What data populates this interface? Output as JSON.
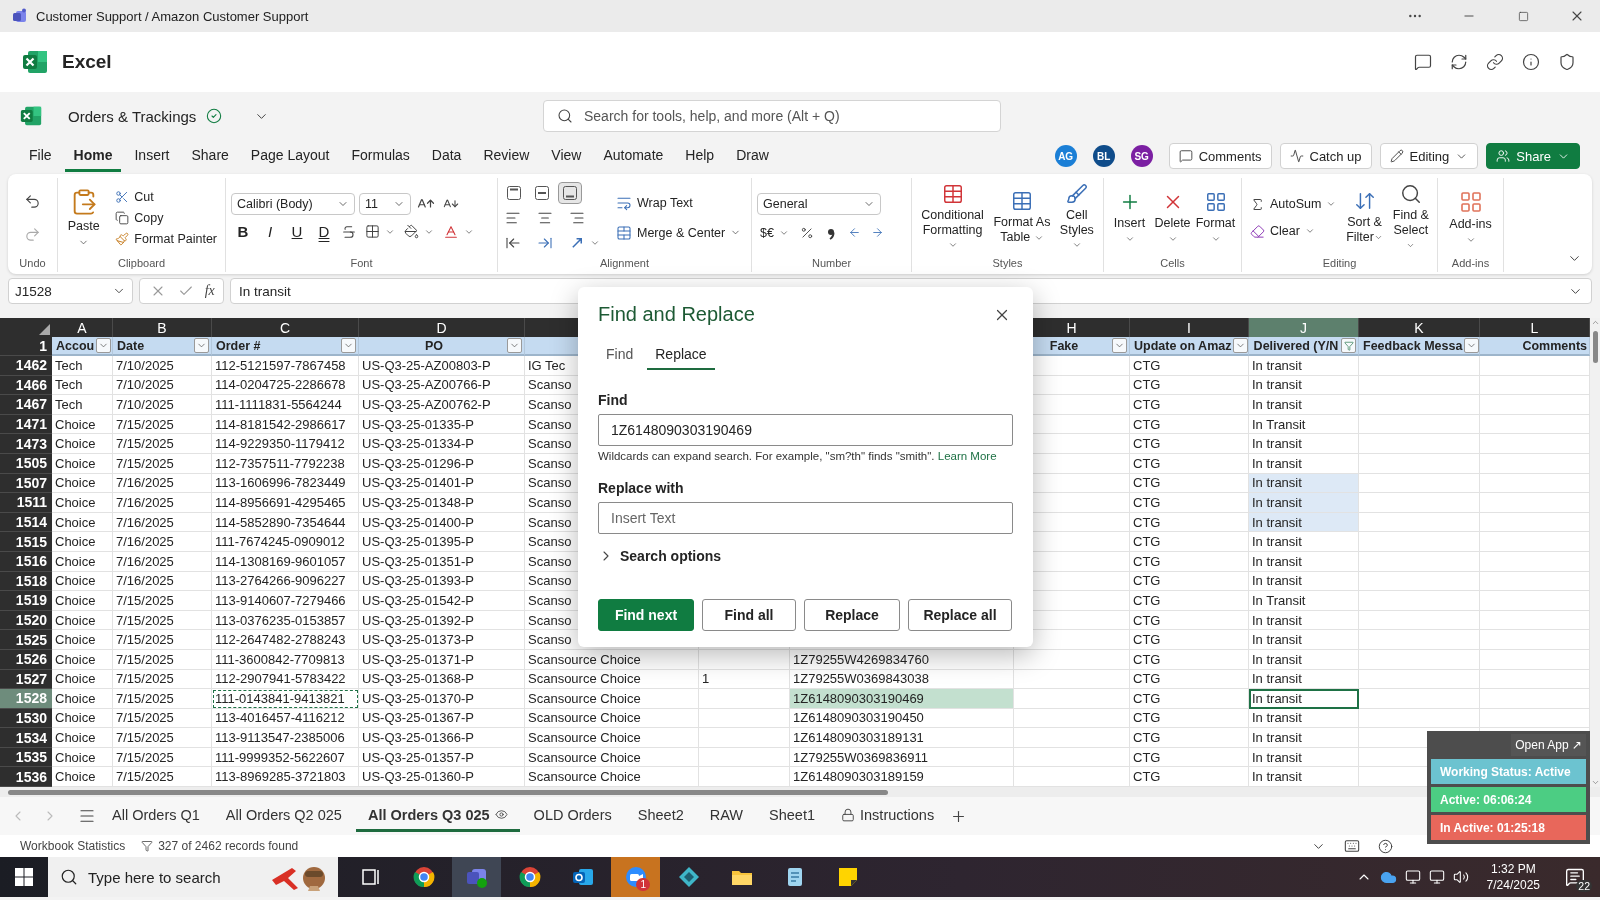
{
  "window": {
    "title": "Customer Support / Amazon Customer Support"
  },
  "app": {
    "name": "Excel"
  },
  "document": {
    "title": "Orders & Trackings",
    "search_placeholder": "Search for tools, help, and more (Alt + Q)"
  },
  "menu": [
    {
      "label": "File",
      "selected": false
    },
    {
      "label": "Home",
      "selected": true
    },
    {
      "label": "Insert",
      "selected": false
    },
    {
      "label": "Share",
      "selected": false
    },
    {
      "label": "Page Layout",
      "selected": false
    },
    {
      "label": "Formulas",
      "selected": false
    },
    {
      "label": "Data",
      "selected": false
    },
    {
      "label": "Review",
      "selected": false
    },
    {
      "label": "View",
      "selected": false
    },
    {
      "label": "Automate",
      "selected": false
    },
    {
      "label": "Help",
      "selected": false
    },
    {
      "label": "Draw",
      "selected": false
    }
  ],
  "collaborators": [
    {
      "initials": "AG",
      "color": "#1b7fd6"
    },
    {
      "initials": "BL",
      "color": "#0f4c8a"
    },
    {
      "initials": "SG",
      "color": "#7b1fa2"
    }
  ],
  "header_buttons": [
    {
      "label": "Comments",
      "kind": "comments"
    },
    {
      "label": "Catch up",
      "kind": "catchup"
    },
    {
      "label": "Editing",
      "kind": "editing"
    },
    {
      "label": "Share",
      "kind": "share"
    }
  ],
  "ribbon": {
    "undo": {
      "group": "Undo"
    },
    "clipboard": {
      "paste": "Paste",
      "cut": "Cut",
      "copy": "Copy",
      "format_painter": "Format Painter",
      "group": "Clipboard"
    },
    "font": {
      "name": "Calibri (Body)",
      "size": "11",
      "styles": [
        "B",
        "I",
        "U",
        "D"
      ],
      "group": "Font"
    },
    "alignment": {
      "vertical": [
        {
          "selected": false
        },
        {
          "selected": false
        },
        {
          "selected": true
        }
      ],
      "wrap": "Wrap Text",
      "merge": "Merge & Center",
      "group": "Alignment"
    },
    "number": {
      "format": "General",
      "currency": "$€",
      "group": "Number"
    },
    "styles": {
      "buttons": [
        "Conditional Formatting",
        "Format As Table",
        "Cell Styles"
      ],
      "group": "Styles"
    },
    "cells": {
      "buttons": [
        "Insert",
        "Delete",
        "Format"
      ],
      "group": "Cells"
    },
    "editing": {
      "autosum": "AutoSum",
      "clear": "Clear",
      "buttons": [
        "Sort & Filter",
        "Find & Select"
      ],
      "group": "Editing"
    },
    "addins": {
      "button": "Add-ins",
      "group": "Add-ins"
    }
  },
  "formula_bar": {
    "cell": "J1528",
    "function_label": "fx",
    "value": "In transit"
  },
  "grid": {
    "columns_left": [
      {
        "letter": "A",
        "heading": "Accou",
        "kind": "dropdown",
        "selected": false
      },
      {
        "letter": "B",
        "heading": "Date",
        "kind": "dropdown",
        "selected": false
      },
      {
        "letter": "C",
        "heading": "Order #",
        "kind": "dropdown",
        "selected": false
      },
      {
        "letter": "D",
        "heading": "PO",
        "kind": "dropdown",
        "selected": false
      }
    ],
    "columns_right": [
      {
        "letter": "H",
        "heading": "Fake",
        "kind": "dropdown",
        "selected": false
      },
      {
        "letter": "I",
        "heading": "Update on Amaz",
        "kind": "dropdown",
        "selected": false
      },
      {
        "letter": "J",
        "heading": "Delivered (Y/N",
        "kind": "filtered",
        "selected": true
      },
      {
        "letter": "K",
        "heading": "Feedback Messa",
        "kind": "dropdown",
        "selected": false
      },
      {
        "letter": "L",
        "heading": "Comments",
        "kind": "plain",
        "selected": false
      }
    ],
    "header_row": "1",
    "rows": [
      {
        "number": "1462",
        "account": "Tech",
        "date": "7/10/2025",
        "order": "112-5121597-7867458",
        "po": "US-Q3-25-AZ00803-P",
        "column_e": "IG Tec",
        "update": "CTG",
        "delivered": "In transit",
        "selected": false,
        "highlighted": false
      },
      {
        "number": "1466",
        "account": "Tech",
        "date": "7/10/2025",
        "order": "114-0204725-2286678",
        "po": "US-Q3-25-AZ00766-P",
        "column_e": "Scanso",
        "update": "CTG",
        "delivered": "In transit",
        "selected": false,
        "highlighted": false
      },
      {
        "number": "1467",
        "account": "Tech",
        "date": "7/10/2025",
        "order": "111-1111831-5564244",
        "po": "US-Q3-25-AZ00762-P",
        "column_e": "Scanso",
        "update": "CTG",
        "delivered": "In transit",
        "selected": false,
        "highlighted": false
      },
      {
        "number": "1471",
        "account": "Choice",
        "date": "7/15/2025",
        "order": "114-8181542-2986617",
        "po": "US-Q3-25-01335-P",
        "column_e": "Scanso",
        "update": "CTG",
        "delivered": "In Transit",
        "selected": false,
        "highlighted": false
      },
      {
        "number": "1473",
        "account": "Choice",
        "date": "7/15/2025",
        "order": "114-9229350-1179412",
        "po": "US-Q3-25-01334-P",
        "column_e": "Scanso",
        "update": "CTG",
        "delivered": "In transit",
        "selected": false,
        "highlighted": false
      },
      {
        "number": "1505",
        "account": "Choice",
        "date": "7/15/2025",
        "order": "112-7357511-7792238",
        "po": "US-Q3-25-01296-P",
        "column_e": "Scanso",
        "update": "CTG",
        "delivered": "In transit",
        "selected": false,
        "highlighted": false
      },
      {
        "number": "1507",
        "account": "Choice",
        "date": "7/16/2025",
        "order": "113-1606996-7823449",
        "po": "US-Q3-25-01401-P",
        "column_e": "Scanso",
        "update": "CTG",
        "delivered": "In transit",
        "selected": false,
        "highlighted": true
      },
      {
        "number": "1511",
        "account": "Choice",
        "date": "7/16/2025",
        "order": "114-8956691-4295465",
        "po": "US-Q3-25-01348-P",
        "column_e": "Scanso",
        "update": "CTG",
        "delivered": "In transit",
        "selected": false,
        "highlighted": true
      },
      {
        "number": "1514",
        "account": "Choice",
        "date": "7/16/2025",
        "order": "114-5852890-7354644",
        "po": "US-Q3-25-01400-P",
        "column_e": "Scanso",
        "update": "CTG",
        "delivered": "In transit",
        "selected": false,
        "highlighted": true
      },
      {
        "number": "1515",
        "account": "Choice",
        "date": "7/16/2025",
        "order": "111-7674245-0909012",
        "po": "US-Q3-25-01395-P",
        "column_e": "Scanso",
        "update": "CTG",
        "delivered": "In transit",
        "selected": false,
        "highlighted": false
      },
      {
        "number": "1516",
        "account": "Choice",
        "date": "7/16/2025",
        "order": "114-1308169-9601057",
        "po": "US-Q3-25-01351-P",
        "column_e": "Scanso",
        "update": "CTG",
        "delivered": "In transit",
        "selected": false,
        "highlighted": false
      },
      {
        "number": "1518",
        "account": "Choice",
        "date": "7/16/2025",
        "order": "113-2764266-9096227",
        "po": "US-Q3-25-01393-P",
        "column_e": "Scanso",
        "update": "CTG",
        "delivered": "In transit",
        "selected": false,
        "highlighted": false
      },
      {
        "number": "1519",
        "account": "Choice",
        "date": "7/15/2025",
        "order": "113-9140607-7279466",
        "po": "US-Q3-25-01542-P",
        "column_e": "Scanso",
        "update": "CTG",
        "delivered": "In Transit",
        "selected": false,
        "highlighted": false
      },
      {
        "number": "1520",
        "account": "Choice",
        "date": "7/15/2025",
        "order": "113-0376235-0153857",
        "po": "US-Q3-25-01392-P",
        "column_e": "Scanso",
        "update": "CTG",
        "delivered": "In transit",
        "selected": false,
        "highlighted": false
      },
      {
        "number": "1525",
        "account": "Choice",
        "date": "7/15/2025",
        "order": "112-2647482-2788243",
        "po": "US-Q3-25-01373-P",
        "column_e": "Scanso",
        "update": "CTG",
        "delivered": "In transit",
        "selected": false,
        "highlighted": false
      },
      {
        "number": "1526",
        "account": "Choice",
        "date": "7/15/2025",
        "order": "111-3600842-7709813",
        "po": "US-Q3-25-01371-P",
        "column_e": "Scansource Choice",
        "column_g": "1Z79255W4269834760",
        "update": "CTG",
        "delivered": "In transit",
        "selected": false,
        "highlighted": false
      },
      {
        "number": "1527",
        "account": "Choice",
        "date": "7/15/2025",
        "order": "112-2907941-5783422",
        "po": "US-Q3-25-01368-P",
        "column_e": "Scansource Choice",
        "column_f": "1",
        "column_g": "1Z79255W0369843038",
        "update": "CTG",
        "delivered": "In transit",
        "selected": false,
        "highlighted": false
      },
      {
        "number": "1528",
        "account": "Choice",
        "date": "7/15/2025",
        "order": "111-0143841-9413821",
        "po": "US-Q3-25-01370-P",
        "column_e": "Scansource Choice",
        "column_g": "1Z6148090303190469",
        "update": "CTG",
        "delivered": "In transit",
        "selected": true,
        "highlighted": false
      },
      {
        "number": "1530",
        "account": "Choice",
        "date": "7/15/2025",
        "order": "113-4016457-4116212",
        "po": "US-Q3-25-01367-P",
        "column_e": "Scansource Choice",
        "column_g": "1Z6148090303190450",
        "update": "CTG",
        "delivered": "In transit",
        "selected": false,
        "highlighted": false
      },
      {
        "number": "1534",
        "account": "Choice",
        "date": "7/15/2025",
        "order": "113-9113547-2385006",
        "po": "US-Q3-25-01366-P",
        "column_e": "Scansource Choice",
        "column_g": "1Z6148090303189131",
        "update": "CTG",
        "delivered": "In transit",
        "selected": false,
        "highlighted": false
      },
      {
        "number": "1535",
        "account": "Choice",
        "date": "7/15/2025",
        "order": "111-9999352-5622607",
        "po": "US-Q3-25-01357-P",
        "column_e": "Scansource Choice",
        "column_g": "1Z79255W0369836911",
        "update": "CTG",
        "delivered": "In transit",
        "selected": false,
        "highlighted": false
      },
      {
        "number": "1536",
        "account": "Choice",
        "date": "7/15/2025",
        "order": "113-8969285-3721803",
        "po": "US-Q3-25-01360-P",
        "column_e": "Scansource Choice",
        "column_g": "1Z6148090303189159",
        "update": "CTG",
        "delivered": "In transit",
        "selected": false,
        "highlighted": false
      }
    ]
  },
  "dialog": {
    "title": "Find and Replace",
    "tabs": [
      {
        "label": "Find",
        "selected": false
      },
      {
        "label": "Replace",
        "selected": true
      }
    ],
    "find_label": "Find",
    "find_value": "1Z6148090303190469",
    "hint": "Wildcards can expand search. For example, \"sm?th\" finds \"smith\".",
    "hint_link": "Learn More",
    "replace_label": "Replace with",
    "replace_placeholder": "Insert Text",
    "search_options": {
      "label": "Search options",
      "expanded": false
    },
    "buttons": [
      {
        "label": "Find next",
        "kind": "primary"
      },
      {
        "label": "Find all",
        "kind": "secondary"
      },
      {
        "label": "Replace",
        "kind": "secondary"
      },
      {
        "label": "Replace all",
        "kind": "secondary"
      }
    ]
  },
  "sheet_tabs": [
    {
      "label": "All Orders Q1",
      "kind": "plain",
      "selected": false
    },
    {
      "label": "All Orders Q2 025",
      "kind": "plain",
      "selected": false
    },
    {
      "label": "All Orders Q3 025",
      "kind": "watched",
      "selected": true
    },
    {
      "label": "OLD Orders",
      "kind": "plain",
      "selected": false
    },
    {
      "label": "Sheet2",
      "kind": "plain",
      "selected": false
    },
    {
      "label": "RAW",
      "kind": "plain",
      "selected": false
    },
    {
      "label": "Sheet1",
      "kind": "plain",
      "selected": false
    },
    {
      "label": "Instructions",
      "kind": "locked",
      "selected": false
    }
  ],
  "status_bar": {
    "statistics": "Workbook Statistics",
    "records": "327 of 2462 records found"
  },
  "widget": {
    "open": "Open App ↗",
    "status": "Working Status: Active",
    "active": "Active: 06:06:24",
    "inactive": "In Active: 01:25:18"
  },
  "taskbar": {
    "search_placeholder": "Type here to search",
    "apps": [
      {
        "kind": "taskview",
        "active": false,
        "attention": false
      },
      {
        "kind": "browser",
        "active": false,
        "attention": false
      },
      {
        "kind": "teams",
        "active": true,
        "attention": false
      },
      {
        "kind": "browser",
        "active": false,
        "attention": false
      },
      {
        "kind": "mail",
        "active": false,
        "attention": false
      },
      {
        "kind": "meeting",
        "active": false,
        "attention": true,
        "badge": "1"
      },
      {
        "kind": "diamond",
        "active": false,
        "attention": false
      },
      {
        "kind": "folder",
        "active": false,
        "attention": false
      },
      {
        "kind": "notes",
        "active": false,
        "attention": false
      },
      {
        "kind": "sticky",
        "active": false,
        "attention": false
      }
    ],
    "time": "1:32 PM",
    "date": "7/24/2025",
    "notifications": "22"
  }
}
